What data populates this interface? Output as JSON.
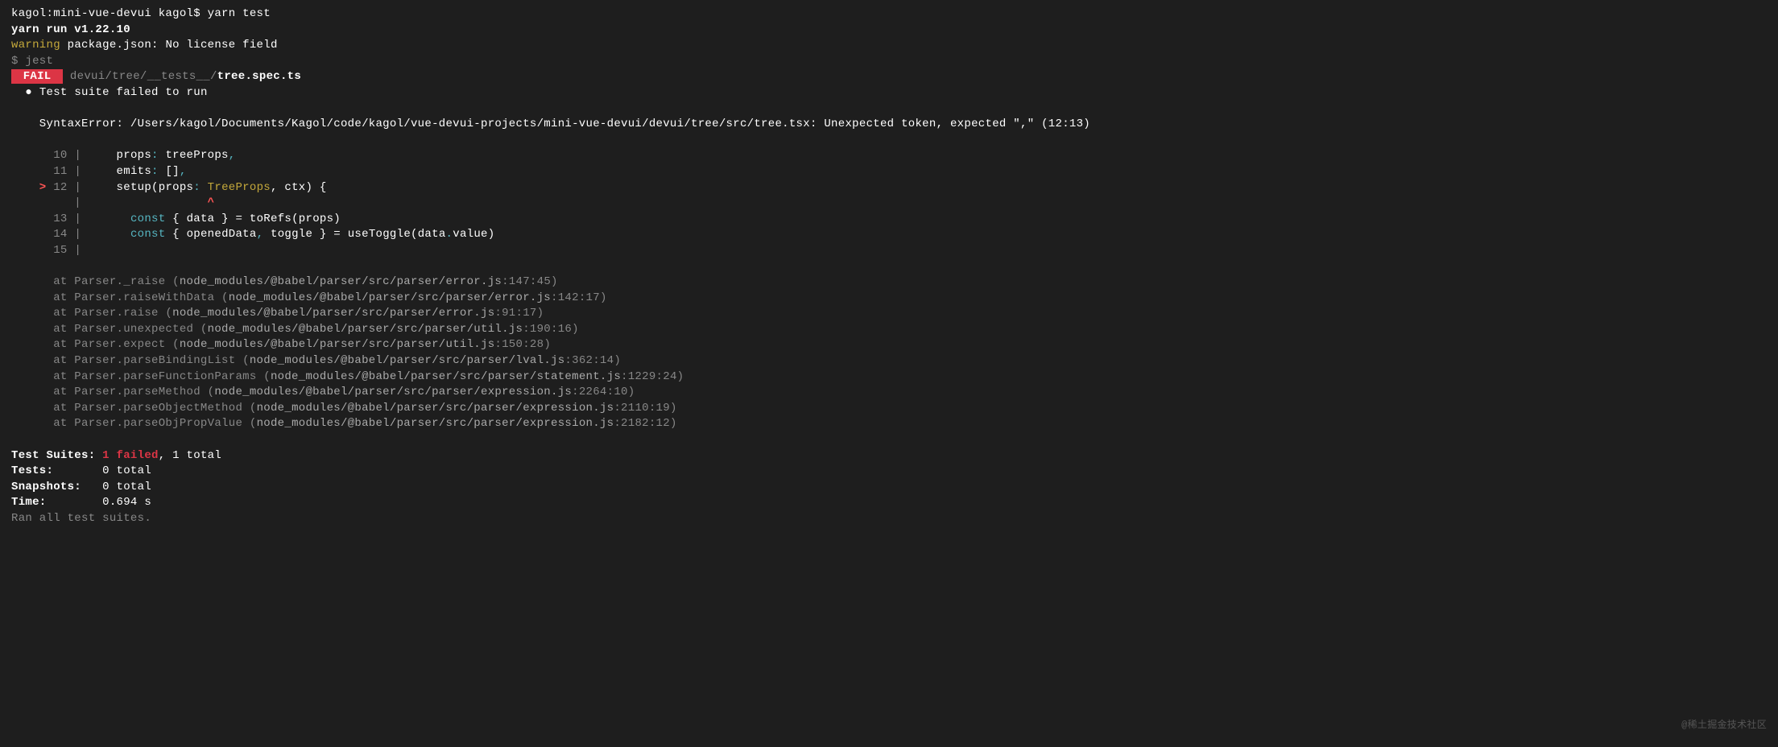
{
  "prompt": {
    "user_host": "kagol:mini-vue-devui kagol$ ",
    "command": "yarn test"
  },
  "yarn_run": "yarn run v1.22.10",
  "warning_label": "warning",
  "warning_msg": " package.json: No license field",
  "jest_cmd": "$ jest",
  "fail_badge": " FAIL ",
  "test_path_prefix": " devui/tree/__tests__/",
  "test_path_file": "tree.spec.ts",
  "suite_fail_prefix": "  ● ",
  "suite_fail_msg": "Test suite failed to run",
  "syntax_error": "    SyntaxError: /Users/kagol/Documents/Kagol/code/kagol/vue-devui-projects/mini-vue-devui/devui/tree/src/tree.tsx: Unexpected token, expected \",\" (12:13)",
  "code": {
    "ln10": {
      "num": "      10",
      "pipe": " | ",
      "text": "    props",
      "colon": ":",
      "rest": " treeProps",
      "comma": ","
    },
    "ln11": {
      "num": "      11",
      "pipe": " | ",
      "text": "    emits",
      "colon": ":",
      "rest": " []",
      "comma": ","
    },
    "ln12": {
      "marker": "    > ",
      "num": "12",
      "pipe": " | ",
      "text": "    setup(props",
      "colon": ":",
      "type": " TreeProps",
      "rest": ", ctx) {"
    },
    "caret": {
      "pad": "         | ",
      "mark": "                 ^"
    },
    "ln13": {
      "num": "      13",
      "pipe": " | ",
      "pad": "      ",
      "kw": "const",
      "rest": " { data } = toRefs(props)"
    },
    "ln14": {
      "num": "      14",
      "pipe": " | ",
      "pad": "      ",
      "kw": "const",
      "rest1": " { openedData",
      "comma": ",",
      "rest2": " toggle } = useToggle(data",
      "dot": ".",
      "rest3": "value)"
    },
    "ln15": {
      "num": "      15",
      "pipe": " | "
    }
  },
  "stack": [
    {
      "prefix": "      at Parser._raise (",
      "path": "node_modules/@babel/parser/src/parser/error.js",
      "loc": ":147:45",
      "close": ")"
    },
    {
      "prefix": "      at Parser.raiseWithData (",
      "path": "node_modules/@babel/parser/src/parser/error.js",
      "loc": ":142:17",
      "close": ")"
    },
    {
      "prefix": "      at Parser.raise (",
      "path": "node_modules/@babel/parser/src/parser/error.js",
      "loc": ":91:17",
      "close": ")"
    },
    {
      "prefix": "      at Parser.unexpected (",
      "path": "node_modules/@babel/parser/src/parser/util.js",
      "loc": ":190:16",
      "close": ")"
    },
    {
      "prefix": "      at Parser.expect (",
      "path": "node_modules/@babel/parser/src/parser/util.js",
      "loc": ":150:28",
      "close": ")"
    },
    {
      "prefix": "      at Parser.parseBindingList (",
      "path": "node_modules/@babel/parser/src/parser/lval.js",
      "loc": ":362:14",
      "close": ")"
    },
    {
      "prefix": "      at Parser.parseFunctionParams (",
      "path": "node_modules/@babel/parser/src/parser/statement.js",
      "loc": ":1229:24",
      "close": ")"
    },
    {
      "prefix": "      at Parser.parseMethod (",
      "path": "node_modules/@babel/parser/src/parser/expression.js",
      "loc": ":2264:10",
      "close": ")"
    },
    {
      "prefix": "      at Parser.parseObjectMethod (",
      "path": "node_modules/@babel/parser/src/parser/expression.js",
      "loc": ":2110:19",
      "close": ")"
    },
    {
      "prefix": "      at Parser.parseObjPropValue (",
      "path": "node_modules/@babel/parser/src/parser/expression.js",
      "loc": ":2182:12",
      "close": ")"
    }
  ],
  "summary": {
    "suites_label": "Test Suites: ",
    "suites_fail": "1 failed",
    "suites_rest": ", 1 total",
    "tests_label": "Tests:       ",
    "tests_val": "0 total",
    "snaps_label": "Snapshots:   ",
    "snaps_val": "0 total",
    "time_label": "Time:        ",
    "time_val": "0.694 s",
    "ran": "Ran all test suites."
  },
  "watermark": "@稀土掘金技术社区"
}
